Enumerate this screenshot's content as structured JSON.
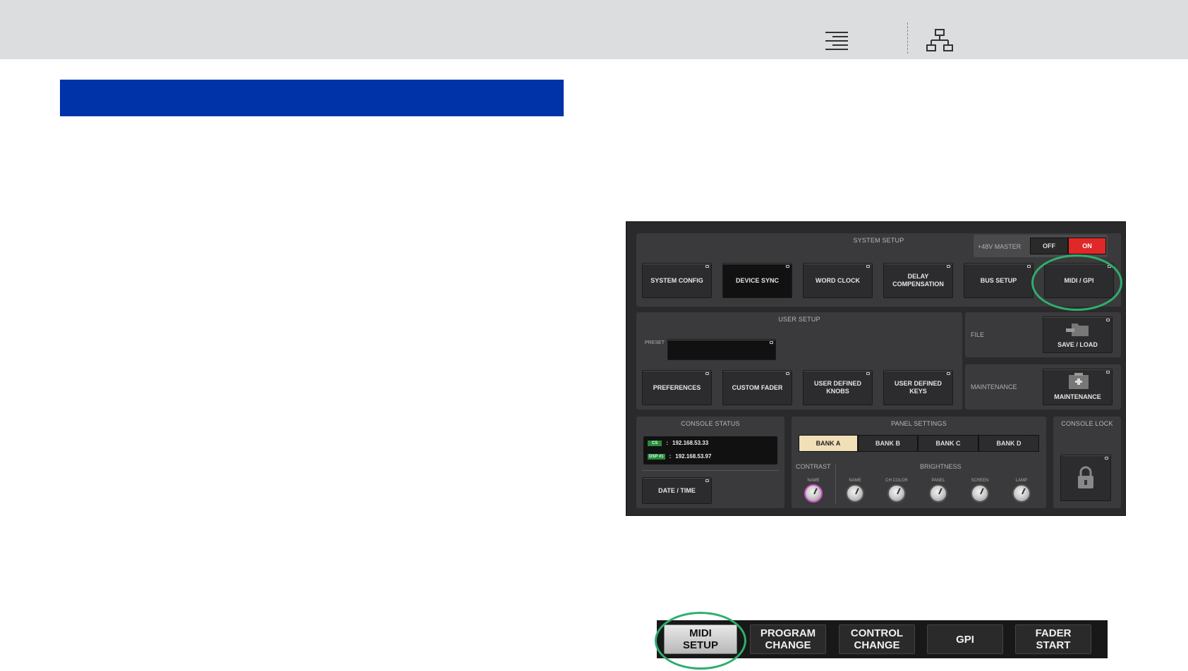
{
  "header": {
    "menu_icon": "text-align-right-icon",
    "sitemap_icon": "sitemap-icon"
  },
  "system_setup": {
    "title": "SYSTEM SETUP",
    "phantom_label": "+48V MASTER",
    "off_label": "OFF",
    "on_label": "ON",
    "buttons": [
      "SYSTEM CONFIG",
      "DEVICE SYNC",
      "WORD CLOCK",
      "DELAY\nCOMPENSATION",
      "BUS SETUP",
      "MIDI / GPI"
    ]
  },
  "user_setup": {
    "title": "USER SETUP",
    "preset_label": "PRESET",
    "buttons": [
      "PREFERENCES",
      "CUSTOM FADER",
      "USER DEFINED\nKNOBS",
      "USER DEFINED\nKEYS"
    ]
  },
  "file": {
    "label": "FILE",
    "button": "SAVE / LOAD"
  },
  "maintenance": {
    "label": "MAINTENANCE",
    "button": "MAINTENANCE"
  },
  "console_status": {
    "title": "CONSOLE STATUS",
    "rows": [
      {
        "tag": "CS",
        "sep": ":",
        "ip": "192.168.53.33"
      },
      {
        "tag": "DSP #1",
        "sep": ":",
        "ip": "192.168.53.97"
      }
    ],
    "date_button": "DATE / TIME"
  },
  "panel_settings": {
    "title": "PANEL SETTINGS",
    "banks": [
      "BANK A",
      "BANK B",
      "BANK C",
      "BANK D"
    ],
    "selected_bank": "BANK A",
    "contrast_label": "CONTRAST",
    "brightness_label": "BRIGHTNESS",
    "contrast_knob": "NAME",
    "brightness_knobs": [
      "NAME",
      "CH COLOR",
      "PANEL",
      "SCREEN",
      "LAMP"
    ]
  },
  "console_lock": {
    "title": "CONSOLE LOCK",
    "icon": "lock-icon"
  },
  "tabs": [
    "MIDI\nSETUP",
    "PROGRAM\nCHANGE",
    "CONTROL\nCHANGE",
    "GPI",
    "FADER\nSTART"
  ],
  "colors": {
    "highlight": "#2eae6e",
    "band": "#0033a8",
    "on": "#e02828"
  }
}
